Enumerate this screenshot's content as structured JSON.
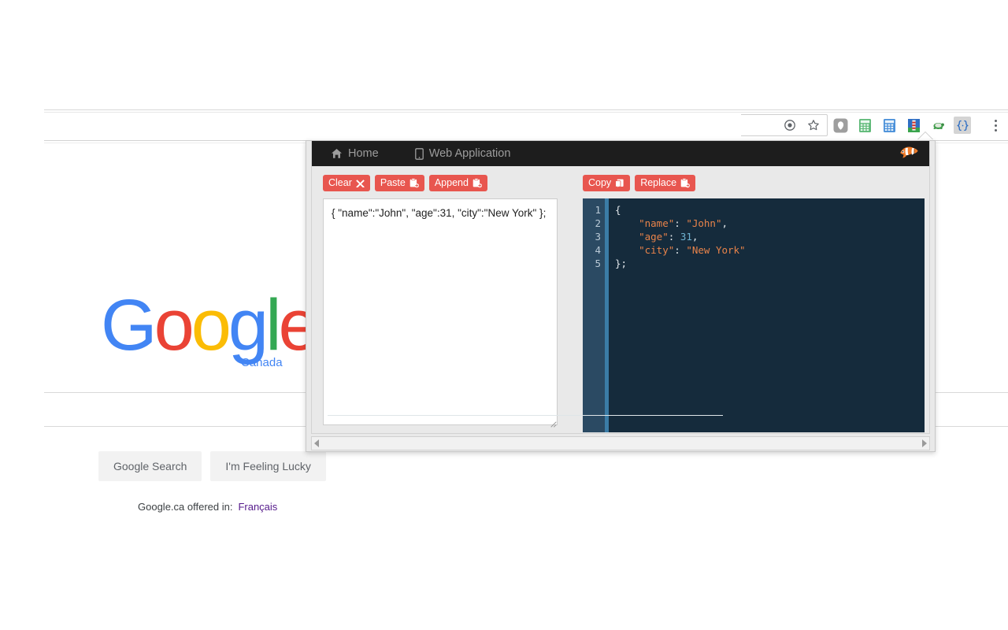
{
  "browser": {
    "omnibox_icons": [
      {
        "name": "page-action-icon",
        "glyph": "target"
      },
      {
        "name": "bookmark-star-icon",
        "glyph": "star"
      }
    ],
    "extension_icons": [
      {
        "name": "extension-adblock-icon",
        "label": "AdBlock"
      },
      {
        "name": "extension-green-calculator-icon",
        "label": "Calculator (green)"
      },
      {
        "name": "extension-blue-calculator-icon",
        "label": "Calculator (blue)"
      },
      {
        "name": "extension-lighthouse-icon",
        "label": "Lighthouse"
      },
      {
        "name": "extension-turtle-icon",
        "label": "Turtle"
      },
      {
        "name": "extension-json-formatter-icon",
        "label": "{...}",
        "active": true
      }
    ],
    "menu_label": "Customize and control Google Chrome"
  },
  "google": {
    "logo_letters": [
      {
        "char": "G",
        "color": "#4285F4"
      },
      {
        "char": "o",
        "color": "#EA4335"
      },
      {
        "char": "o",
        "color": "#FBBC05"
      },
      {
        "char": "g",
        "color": "#4285F4"
      },
      {
        "char": "l",
        "color": "#34A853"
      },
      {
        "char": "e",
        "color": "#EA4335"
      }
    ],
    "country_label": "Canada",
    "search_placeholder": "",
    "search_value": "",
    "buttons": [
      {
        "name": "google-search-button",
        "label": "Google Search"
      },
      {
        "name": "feeling-lucky-button",
        "label": "I'm Feeling Lucky"
      }
    ],
    "offered_in_text": "Google.ca offered in:",
    "offered_in_language": "Français"
  },
  "popup": {
    "nav": {
      "items": [
        {
          "name": "nav-home",
          "label": "Home",
          "icon": "home-icon"
        },
        {
          "name": "nav-web-application",
          "label": "Web Application",
          "icon": "mobile-icon"
        }
      ],
      "logo_icon": "clownfish-logo-icon"
    },
    "left_panel": {
      "buttons": [
        {
          "name": "clear-button",
          "label": "Clear",
          "icon": "times-icon"
        },
        {
          "name": "paste-button",
          "label": "Paste",
          "icon": "clipboard-plus-icon"
        },
        {
          "name": "append-button",
          "label": "Append",
          "icon": "clipboard-plus-icon"
        }
      ],
      "input_value": "{ \"name\":\"John\", \"age\":31, \"city\":\"New York\" };",
      "input_placeholder": ""
    },
    "right_panel": {
      "buttons": [
        {
          "name": "copy-button",
          "label": "Copy",
          "icon": "copy-icon"
        },
        {
          "name": "replace-button",
          "label": "Replace",
          "icon": "clipboard-icon"
        }
      ],
      "editor": {
        "line_numbers": [
          "1",
          "2",
          "3",
          "4",
          "5"
        ],
        "lines": [
          [
            {
              "t": "punc",
              "v": "{"
            }
          ],
          [
            {
              "t": "punc",
              "v": "    "
            },
            {
              "t": "key",
              "v": "\"name\""
            },
            {
              "t": "punc",
              "v": ": "
            },
            {
              "t": "str",
              "v": "\"John\""
            },
            {
              "t": "punc",
              "v": ","
            }
          ],
          [
            {
              "t": "punc",
              "v": "    "
            },
            {
              "t": "key",
              "v": "\"age\""
            },
            {
              "t": "punc",
              "v": ": "
            },
            {
              "t": "num",
              "v": "31"
            },
            {
              "t": "punc",
              "v": ","
            }
          ],
          [
            {
              "t": "punc",
              "v": "    "
            },
            {
              "t": "key",
              "v": "\"city\""
            },
            {
              "t": "punc",
              "v": ": "
            },
            {
              "t": "str",
              "v": "\"New York\""
            }
          ],
          [
            {
              "t": "punc",
              "v": "};"
            }
          ]
        ]
      }
    },
    "colors": {
      "button_red": "#e8564f",
      "navbar_dark": "#1d1d1d",
      "editor_bg": "#152B3C",
      "gutter_bg": "#2B4A63",
      "active_line_bar": "#3b7ca6",
      "token_string": "#e8834a",
      "token_number": "#6fb3d2"
    }
  }
}
